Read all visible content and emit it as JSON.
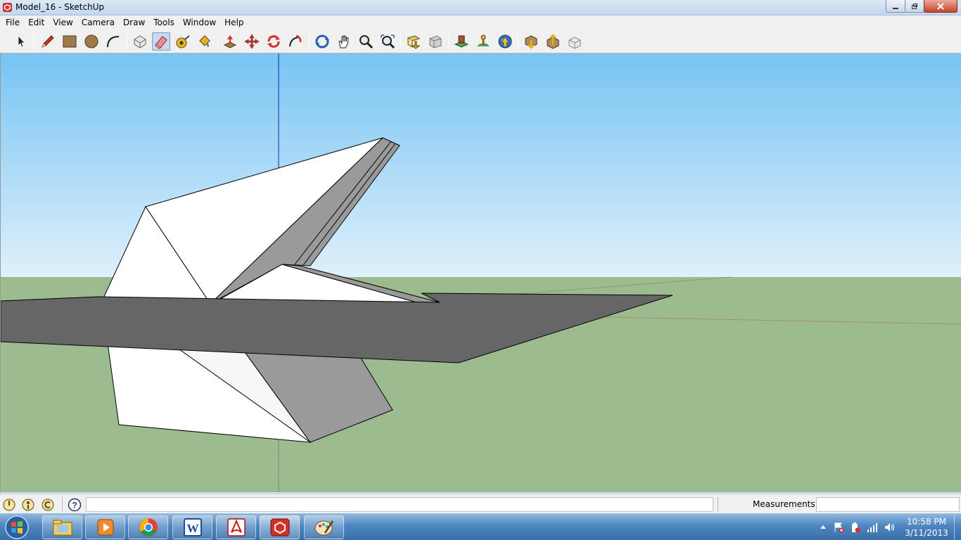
{
  "window": {
    "title": "Model_16 - SketchUp"
  },
  "menu": [
    "File",
    "Edit",
    "View",
    "Camera",
    "Draw",
    "Tools",
    "Window",
    "Help"
  ],
  "toolbar": {
    "tools": [
      {
        "name": "select-tool-icon"
      },
      {
        "name": "pencil-line-tool-icon"
      },
      {
        "name": "rectangle-tool-icon"
      },
      {
        "name": "circle-tool-icon"
      },
      {
        "name": "arc-tool-icon"
      },
      {
        "name": "make-component-icon"
      },
      {
        "name": "eraser-tool-icon"
      },
      {
        "name": "tape-measure-tool-icon"
      },
      {
        "name": "paint-bucket-tool-icon"
      },
      {
        "name": "push-pull-tool-icon"
      },
      {
        "name": "move-tool-icon"
      },
      {
        "name": "rotate-tool-icon"
      },
      {
        "name": "follow-me-tool-icon"
      },
      {
        "name": "orbit-tool-icon"
      },
      {
        "name": "pan-tool-icon"
      },
      {
        "name": "zoom-tool-icon"
      },
      {
        "name": "zoom-extents-tool-icon"
      },
      {
        "name": "previous-view-icon"
      },
      {
        "name": "next-view-icon"
      },
      {
        "name": "add-location-icon"
      },
      {
        "name": "toggle-terrain-icon"
      },
      {
        "name": "google-earth-icon"
      },
      {
        "name": "get-models-icon"
      },
      {
        "name": "share-model-icon"
      },
      {
        "name": "share-component-icon"
      }
    ],
    "active_tool": "eraser-tool-icon"
  },
  "colors": {
    "sky_top": "#77c4f3",
    "sky_bottom": "#dff0fb",
    "ground": "#9cbb8e",
    "face_white": "#ffffff",
    "face_dark": "#666666",
    "face_mid": "#9a9a9a",
    "axis_blue": "#1f1fa8",
    "axis_red": "#b33a2a",
    "axis_green": "#2f7a2f"
  },
  "statusbar": {
    "measurements_label": "Measurements",
    "measurements_value": ""
  },
  "taskbar": {
    "apps": [
      "file-explorer-icon",
      "media-player-icon",
      "chrome-icon",
      "word-icon",
      "acrobat-icon",
      "sketchup-icon",
      "paint-icon"
    ],
    "active_app": "sketchup-icon"
  },
  "clock": {
    "time": "10:58 PM",
    "date": "3/11/2013"
  }
}
